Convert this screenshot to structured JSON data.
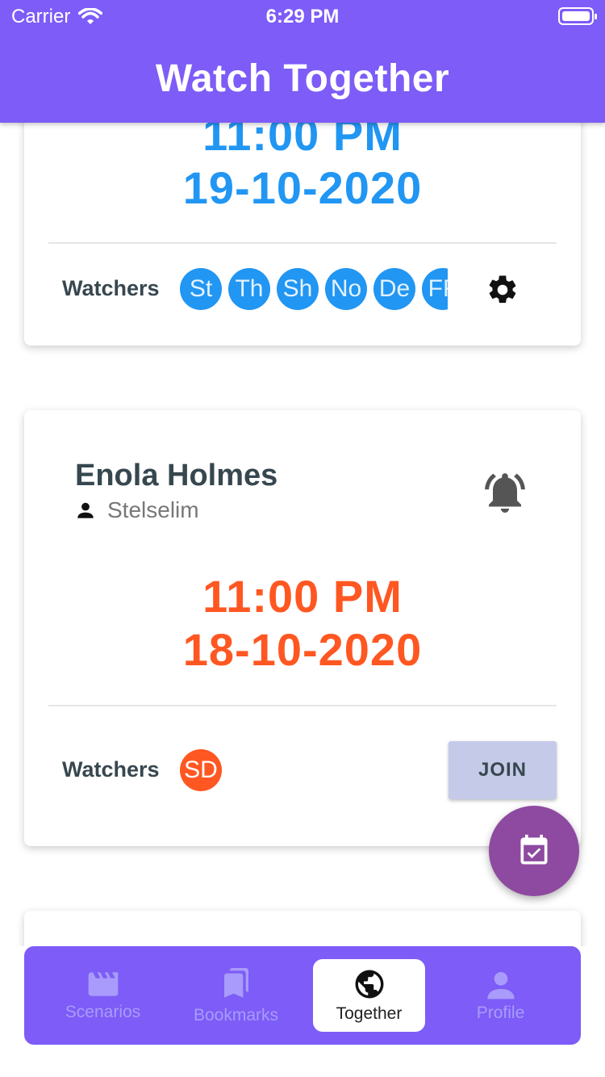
{
  "status": {
    "carrier": "Carrier",
    "time": "6:29 PM"
  },
  "app": {
    "title": "Watch Together"
  },
  "cards": [
    {
      "time": "11:00 PM",
      "date": "19-10-2020",
      "watchers_label": "Watchers",
      "watchers": [
        "St",
        "Th",
        "Sh",
        "No",
        "De",
        "FF"
      ],
      "accent": "#2196f3"
    },
    {
      "title": "Enola Holmes",
      "owner": "Stelselim",
      "time": "11:00 PM",
      "date": "18-10-2020",
      "watchers_label": "Watchers",
      "watchers": [
        "SD"
      ],
      "join_label": "JOIN",
      "accent": "#ff5722"
    }
  ],
  "icons": {
    "settings": "gear-icon",
    "notify": "bell-ring-icon",
    "fab": "calendar-check-icon"
  },
  "nav": [
    {
      "label": "Scenarios",
      "icon": "movie-icon",
      "active": false
    },
    {
      "label": "Bookmarks",
      "icon": "bookmarks-icon",
      "active": false
    },
    {
      "label": "Together",
      "icon": "globe-icon",
      "active": true
    },
    {
      "label": "Profile",
      "icon": "person-icon",
      "active": false
    }
  ],
  "colors": {
    "primary": "#7d5cf7",
    "fab": "#8e4aa0",
    "join": "#c5cae9"
  }
}
